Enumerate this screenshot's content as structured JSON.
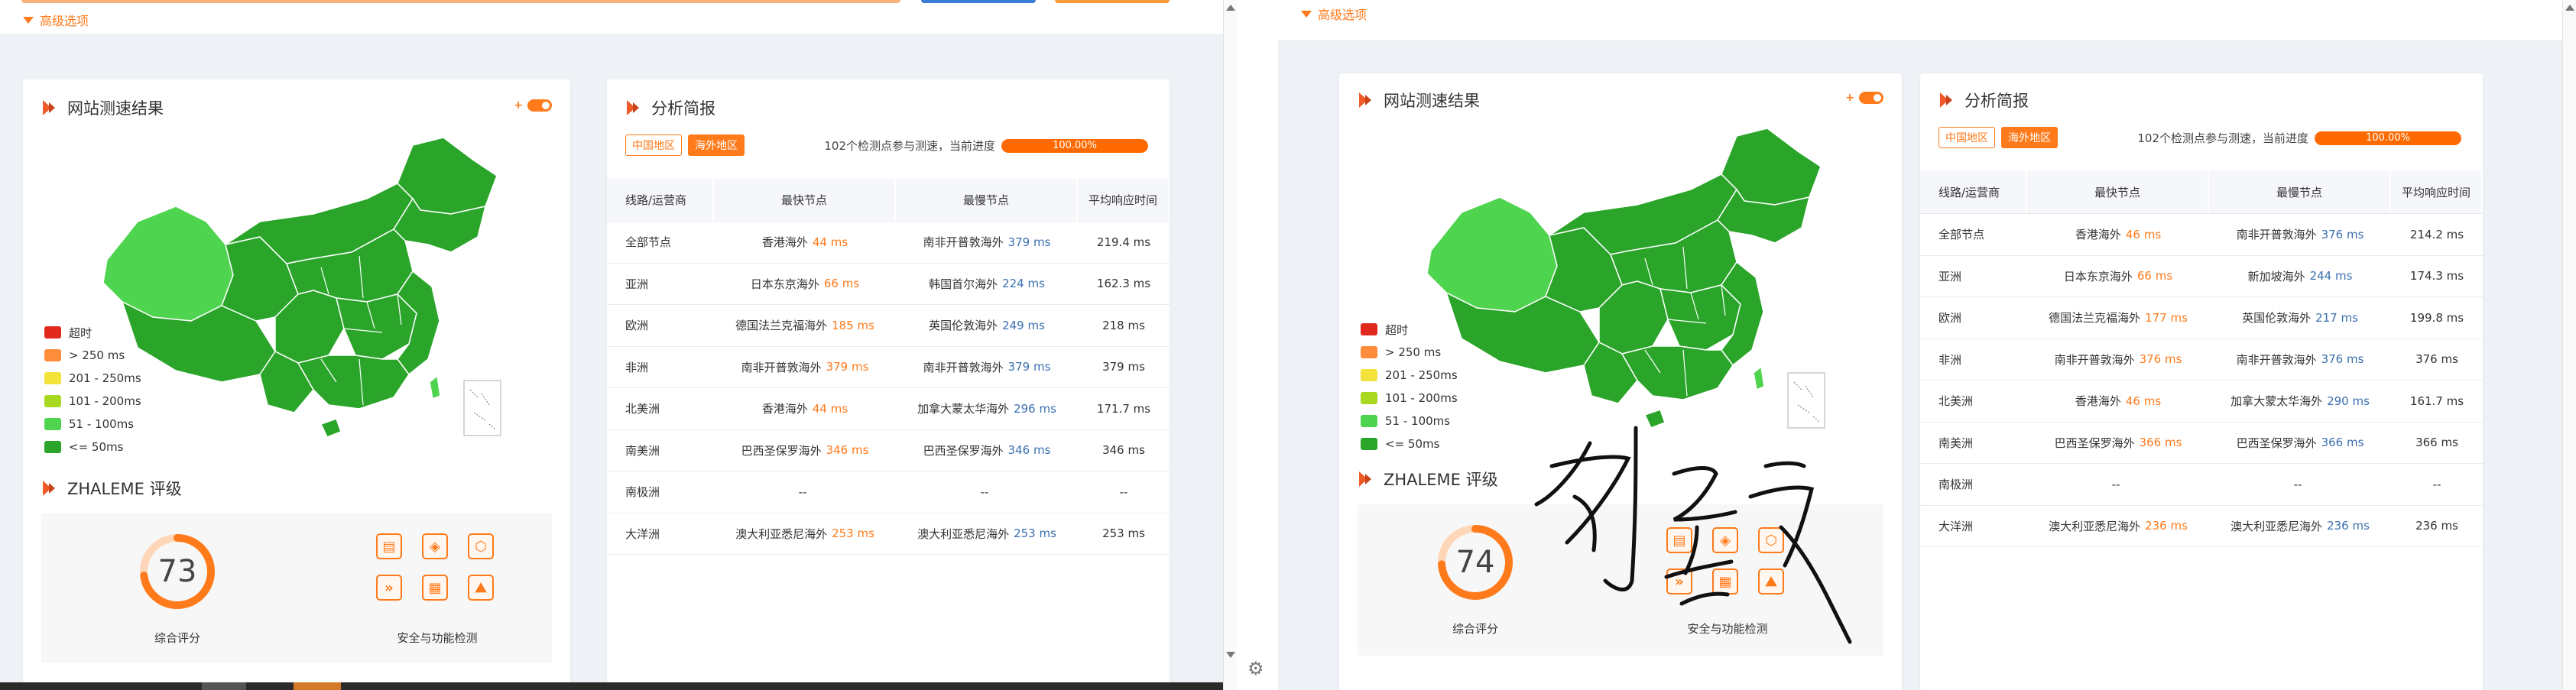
{
  "colors": {
    "accent": "#ff7a1a",
    "map_dark": "#2aa52a",
    "map_light": "#4fd44f",
    "map_border": "#ffffff"
  },
  "common": {
    "advanced_options": "高级选项",
    "speed_panel_title": "网站测速结果",
    "toggle_symbol": "+",
    "rating_title": "ZHALEME 评级",
    "score_label": "综合评分",
    "security_label": "安全与功能检测",
    "analysis_title": "分析简报",
    "tab_china": "中国地区",
    "tab_overseas": "海外地区",
    "progress_text": "102个检测点参与测速，当前进度",
    "progress_value": "100.00%",
    "progress_fraction": 1.0,
    "legend": [
      {
        "label": "超时",
        "color": "#e0281c"
      },
      {
        "label": "> 250 ms",
        "color": "#ff8c3a"
      },
      {
        "label": "201 - 250ms",
        "color": "#f2e23a"
      },
      {
        "label": "101 - 200ms",
        "color": "#a8d820"
      },
      {
        "label": "51 - 100ms",
        "color": "#4fd44f"
      },
      {
        "label": "<= 50ms",
        "color": "#2aa52a"
      }
    ],
    "headers": [
      "线路/运营商",
      "最快节点",
      "最慢节点",
      "平均响应时间"
    ],
    "security_icons": [
      "server-shield-icon",
      "cube-icon",
      "hexagon-shield-icon",
      "speed-icon",
      "grid-badge-icon",
      "image-icon"
    ]
  },
  "left": {
    "score": "73",
    "score_fraction": 0.73,
    "rows": [
      {
        "region": "全部节点",
        "fast_node": "香港海外",
        "fast_ms": "44 ms",
        "slow_node": "南非开普敦海外",
        "slow_ms": "379 ms",
        "avg": "219.4 ms"
      },
      {
        "region": "亚洲",
        "fast_node": "日本东京海外",
        "fast_ms": "66 ms",
        "slow_node": "韩国首尔海外",
        "slow_ms": "224 ms",
        "avg": "162.3 ms"
      },
      {
        "region": "欧洲",
        "fast_node": "德国法兰克福海外",
        "fast_ms": "185 ms",
        "slow_node": "英国伦敦海外",
        "slow_ms": "249 ms",
        "avg": "218 ms"
      },
      {
        "region": "非洲",
        "fast_node": "南非开普敦海外",
        "fast_ms": "379 ms",
        "slow_node": "南非开普敦海外",
        "slow_ms": "379 ms",
        "avg": "379 ms"
      },
      {
        "region": "北美洲",
        "fast_node": "香港海外",
        "fast_ms": "44 ms",
        "slow_node": "加拿大蒙太华海外",
        "slow_ms": "296 ms",
        "avg": "171.7 ms"
      },
      {
        "region": "南美洲",
        "fast_node": "巴西圣保罗海外",
        "fast_ms": "346 ms",
        "slow_node": "巴西圣保罗海外",
        "slow_ms": "346 ms",
        "avg": "346 ms"
      },
      {
        "region": "南极洲",
        "fast_node": "--",
        "fast_ms": "",
        "slow_node": "--",
        "slow_ms": "",
        "avg": "--"
      },
      {
        "region": "大洋洲",
        "fast_node": "澳大利亚悉尼海外",
        "fast_ms": "253 ms",
        "slow_node": "澳大利亚悉尼海外",
        "slow_ms": "253 ms",
        "avg": "253 ms"
      }
    ]
  },
  "right": {
    "score": "74",
    "score_fraction": 0.74,
    "rows": [
      {
        "region": "全部节点",
        "fast_node": "香港海外",
        "fast_ms": "46 ms",
        "slow_node": "南非开普敦海外",
        "slow_ms": "376 ms",
        "avg": "214.2 ms"
      },
      {
        "region": "亚洲",
        "fast_node": "日本东京海外",
        "fast_ms": "66 ms",
        "slow_node": "新加坡海外",
        "slow_ms": "244 ms",
        "avg": "174.3 ms"
      },
      {
        "region": "欧洲",
        "fast_node": "德国法兰克福海外",
        "fast_ms": "177 ms",
        "slow_node": "英国伦敦海外",
        "slow_ms": "217 ms",
        "avg": "199.8 ms"
      },
      {
        "region": "非洲",
        "fast_node": "南非开普敦海外",
        "fast_ms": "376 ms",
        "slow_node": "南非开普敦海外",
        "slow_ms": "376 ms",
        "avg": "376 ms"
      },
      {
        "region": "北美洲",
        "fast_node": "香港海外",
        "fast_ms": "46 ms",
        "slow_node": "加拿大蒙太华海外",
        "slow_ms": "290 ms",
        "avg": "161.7 ms"
      },
      {
        "region": "南美洲",
        "fast_node": "巴西圣保罗海外",
        "fast_ms": "366 ms",
        "slow_node": "巴西圣保罗海外",
        "slow_ms": "366 ms",
        "avg": "366 ms"
      },
      {
        "region": "南极洲",
        "fast_node": "--",
        "fast_ms": "",
        "slow_node": "--",
        "slow_ms": "",
        "avg": "--"
      },
      {
        "region": "大洋洲",
        "fast_node": "澳大利亚悉尼海外",
        "fast_ms": "236 ms",
        "slow_node": "澳大利亚悉尼海外",
        "slow_ms": "236 ms",
        "avg": "236 ms"
      }
    ]
  }
}
